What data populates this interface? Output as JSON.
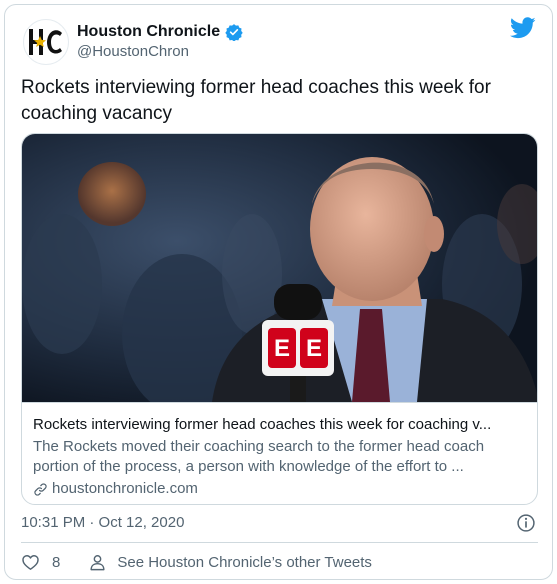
{
  "author": {
    "display_name": "Houston Chronicle",
    "handle": "@HoustonChron",
    "avatar_text": "HC"
  },
  "tweet_text": "Rockets interviewing former head coaches this week for coaching vacancy",
  "card": {
    "title": "Rockets interviewing former head coaches this week for coaching v...",
    "description": "The Rockets moved their coaching search to the former head coach portion of the process, a person with knowledge of the effort to ...",
    "domain": "houstonchronicle.com",
    "image_logo_text": "E"
  },
  "timestamp": "10:31 PM · Oct 12, 2020",
  "actions": {
    "like_count": "8",
    "see_other_label": "See Houston Chronicle’s other Tweets"
  },
  "colors": {
    "twitter_blue": "#1d9bf0",
    "secondary_text": "#536471",
    "border": "#cfd9de",
    "espn_red": "#d0021b"
  },
  "icons": [
    "verified-badge-icon",
    "twitter-bird-icon",
    "link-icon",
    "info-icon",
    "heart-icon",
    "person-icon"
  ]
}
